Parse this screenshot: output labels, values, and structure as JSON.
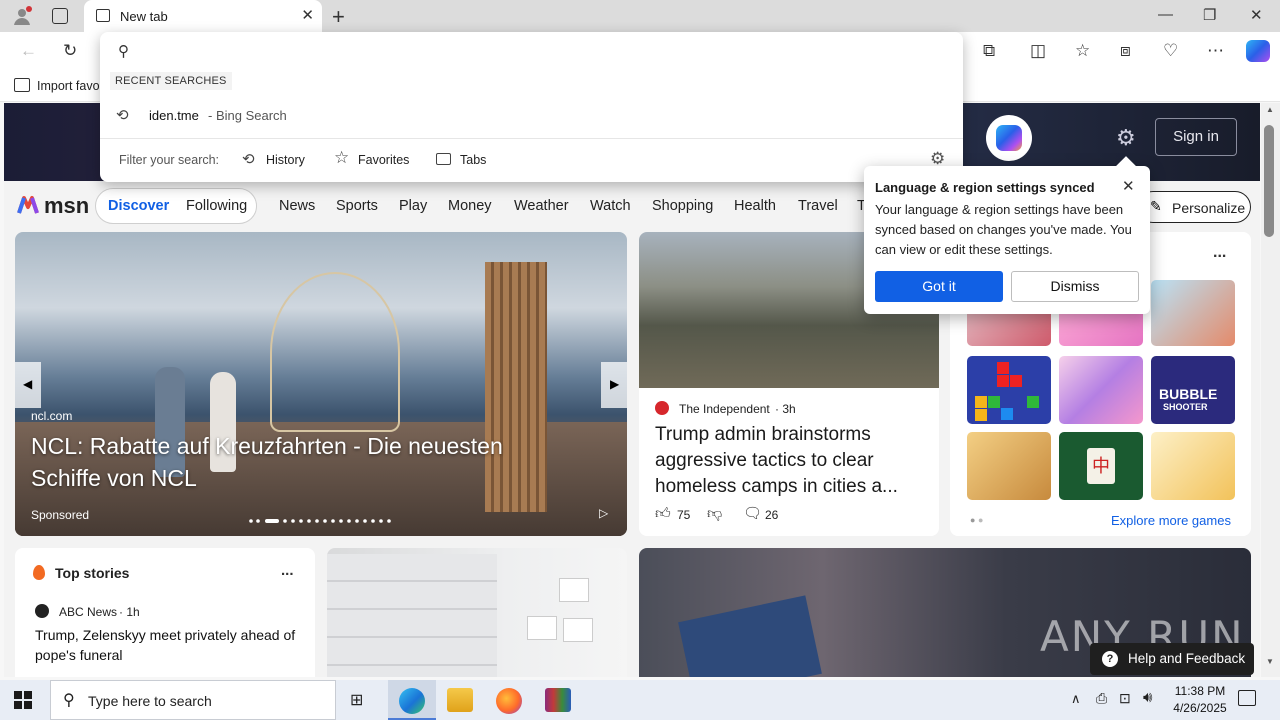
{
  "browser": {
    "tab_title": "New tab",
    "new_tab_label": "+",
    "window_controls": [
      "—",
      "❐",
      "✕"
    ],
    "favbar_item": "Import favo"
  },
  "omnibox": {
    "placeholder": "",
    "recent_header": "RECENT SEARCHES",
    "recent_query": "iden.tme",
    "recent_source": "- Bing Search",
    "filter_label": "Filter your search:",
    "filters": [
      "History",
      "Favorites",
      "Tabs"
    ]
  },
  "msn": {
    "logo": "msn",
    "sign_in": "Sign in",
    "personalize": "Personalize",
    "nav": [
      "Discover",
      "Following",
      "News",
      "Sports",
      "Play",
      "Money",
      "Weather",
      "Watch",
      "Shopping",
      "Health",
      "Travel",
      "T"
    ],
    "hero": {
      "source": "ncl.com",
      "title": "NCL: Rabatte auf Kreuzfahrten - Die neuesten Schiffe von NCL",
      "sponsored": "Sponsored"
    },
    "story": {
      "source": "The Independent",
      "age": "· 3h",
      "title": "Trump admin brainstorms aggressive tactics to clear homeless camps in cities a...",
      "likes": "75",
      "comments": "26"
    },
    "games": {
      "more_label": "Explore more games",
      "menu": "..."
    },
    "top_stories": {
      "title": "Top stories",
      "menu": "...",
      "source": "ABC News",
      "age": "· 1h",
      "headline": "Trump, Zelenskyy meet privately ahead of pope's funeral"
    }
  },
  "popup": {
    "title": "Language & region settings synced",
    "body": "Your language & region settings have been synced based on changes you've made. You can view or edit these settings.",
    "got_it": "Got it",
    "dismiss": "Dismiss"
  },
  "help": "Help and Feedback",
  "watermark": "ANY RUN",
  "taskbar": {
    "search_placeholder": "Type here to search",
    "time": "11:38 PM",
    "date": "4/26/2025"
  }
}
